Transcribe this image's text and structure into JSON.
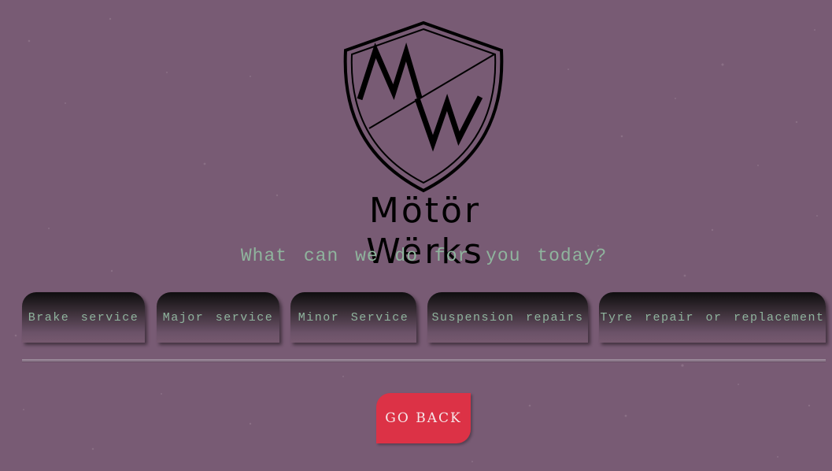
{
  "brand": {
    "name": "Mötör Wërks",
    "monogram": "MW"
  },
  "prompt": "What can we do for you today?",
  "services": [
    {
      "label": "Brake service"
    },
    {
      "label": "Major service"
    },
    {
      "label": "Minor Service"
    },
    {
      "label": "Suspension repairs"
    },
    {
      "label": "Tyre repair or replacement"
    }
  ],
  "actions": {
    "go_back_label": "GO BACK"
  },
  "colors": {
    "background": "#785b74",
    "accent_text": "#8fb49d",
    "button_red": "#dc3246"
  },
  "icons": {
    "logo": "shield-logo-icon"
  }
}
